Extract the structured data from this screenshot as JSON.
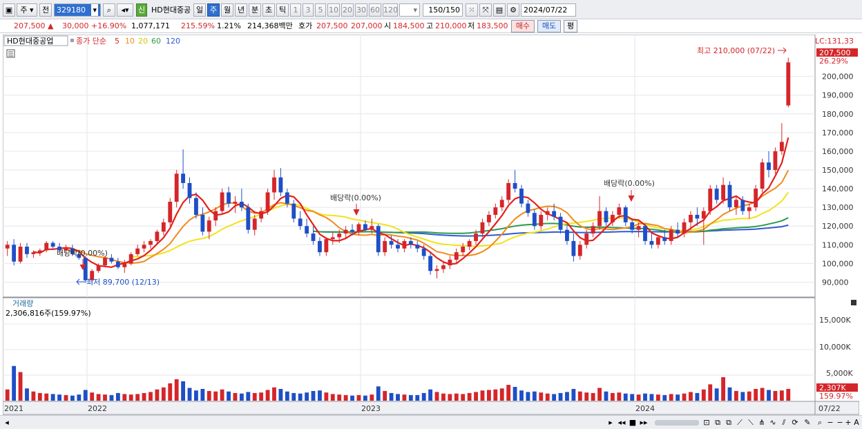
{
  "toolbar": {
    "market": "주",
    "prev": "전",
    "code": "329180",
    "shin": "신",
    "stock_name": "HD현대중공",
    "periods": [
      "일",
      "주",
      "월",
      "년",
      "분",
      "초",
      "틱"
    ],
    "active_period": "주",
    "intervals": [
      "1",
      "3",
      "5",
      "10",
      "20",
      "30",
      "60",
      "120"
    ],
    "count": "150",
    "count_total": "/150",
    "date": "2024/07/22"
  },
  "quote": {
    "price": "207,500",
    "change": "30,000",
    "change_pct": "+16.90%",
    "volume": "1,077,171",
    "volume_pct": "215.59%",
    "turnover_pct": "1.21%",
    "amount": "214,368백만",
    "bid_label": "호가",
    "ask": "207,500",
    "bid": "207,000",
    "open_label": "시",
    "open": "184,500",
    "high_label": "고",
    "high": "210,000",
    "low_label": "저",
    "low": "183,500",
    "buy_button": "매수",
    "sell_button": "매도",
    "avg_button": "평"
  },
  "legend": {
    "name": "HD현대중공업",
    "series_label": "종가 단순",
    "ma": [
      "5",
      "10",
      "20",
      "60",
      "120"
    ]
  },
  "colors": {
    "up": "#d4262a",
    "down": "#1e4fc6",
    "ma5": "#e3201b",
    "ma10": "#f08a1c",
    "ma20": "#f2e21a",
    "ma60": "#2e9a4c",
    "ma120": "#2d5ad6"
  },
  "price_axis": {
    "lc": "LC:131,33",
    "ticks": [
      "200,000",
      "190,000",
      "180,000",
      "170,000",
      "160,000",
      "150,000",
      "140,000",
      "130,000",
      "120,000",
      "110,000",
      "100,000",
      "90,000"
    ],
    "current_price_label": "207,500",
    "current_pct_label": "26.29%"
  },
  "annotations": {
    "high": "최고 210,000 (07/22)",
    "low": "최저 89,700 (12/13)",
    "dividend": "배당락(0.00%)"
  },
  "volume": {
    "title": "거래량",
    "max_label": "2,306,816주(159.97%)",
    "ticks": [
      "15,000K",
      "10,000K",
      "5,000K"
    ],
    "current_label": "2,307K",
    "current_pct": "159.97%"
  },
  "date_axis": [
    "2021",
    "2022",
    "2023",
    "2024",
    "07/22"
  ],
  "chart_data": {
    "type": "candlestick",
    "interval": "weekly",
    "ylim": [
      85000,
      215000
    ],
    "volume_ylim": [
      0,
      18000
    ],
    "candles": [
      [
        108000,
        112000,
        104000,
        110000,
        2200
      ],
      [
        110000,
        113000,
        99000,
        101000,
        6800
      ],
      [
        101000,
        111000,
        100000,
        109000,
        5600
      ],
      [
        109000,
        111000,
        103000,
        105000,
        2400
      ],
      [
        105000,
        107000,
        103000,
        106000,
        1800
      ],
      [
        106000,
        108000,
        104000,
        107000,
        1500
      ],
      [
        107000,
        112000,
        106000,
        111000,
        1400
      ],
      [
        111000,
        112000,
        108000,
        109000,
        1300
      ],
      [
        109000,
        111000,
        106000,
        107000,
        1200
      ],
      [
        107000,
        110000,
        105000,
        108000,
        1100
      ],
      [
        108000,
        110000,
        104000,
        105000,
        1000
      ],
      [
        105000,
        107000,
        102000,
        103000,
        1200
      ],
      [
        103000,
        104000,
        89700,
        91000,
        2100
      ],
      [
        91000,
        97000,
        90000,
        96000,
        1600
      ],
      [
        96000,
        100000,
        95000,
        99000,
        1300
      ],
      [
        99000,
        104000,
        98000,
        103000,
        1200
      ],
      [
        103000,
        105000,
        100000,
        101000,
        1100
      ],
      [
        101000,
        103000,
        97000,
        98000,
        1500
      ],
      [
        98000,
        102000,
        95000,
        100000,
        1300
      ],
      [
        100000,
        106000,
        99000,
        105000,
        1200
      ],
      [
        105000,
        110000,
        104000,
        108000,
        1300
      ],
      [
        108000,
        112000,
        106000,
        110000,
        1500
      ],
      [
        110000,
        113000,
        108000,
        112000,
        1700
      ],
      [
        112000,
        118000,
        110000,
        117000,
        2200
      ],
      [
        117000,
        124000,
        115000,
        122000,
        2600
      ],
      [
        122000,
        135000,
        120000,
        133000,
        3400
      ],
      [
        133000,
        150000,
        130000,
        148000,
        4200
      ],
      [
        148000,
        161000,
        140000,
        143000,
        3800
      ],
      [
        143000,
        146000,
        132000,
        135000,
        2500
      ],
      [
        135000,
        138000,
        124000,
        126000,
        2000
      ],
      [
        126000,
        130000,
        115000,
        117000,
        2300
      ],
      [
        117000,
        125000,
        113000,
        123000,
        1900
      ],
      [
        123000,
        130000,
        120000,
        128000,
        1800
      ],
      [
        128000,
        140000,
        126000,
        138000,
        2200
      ],
      [
        138000,
        141000,
        130000,
        132000,
        1800
      ],
      [
        132000,
        136000,
        127000,
        133000,
        1500
      ],
      [
        133000,
        140000,
        128000,
        130000,
        1400
      ],
      [
        130000,
        132000,
        116000,
        118000,
        1700
      ],
      [
        118000,
        126000,
        115000,
        124000,
        1500
      ],
      [
        124000,
        130000,
        122000,
        128000,
        1600
      ],
      [
        128000,
        140000,
        126000,
        138000,
        2100
      ],
      [
        138000,
        150000,
        134000,
        146000,
        2600
      ],
      [
        146000,
        151000,
        136000,
        138000,
        2300
      ],
      [
        138000,
        140000,
        130000,
        132000,
        1800
      ],
      [
        132000,
        134000,
        122000,
        124000,
        1500
      ],
      [
        124000,
        128000,
        118000,
        120000,
        1400
      ],
      [
        120000,
        124000,
        114000,
        116000,
        1600
      ],
      [
        116000,
        120000,
        110000,
        112000,
        1900
      ],
      [
        112000,
        114000,
        104000,
        106000,
        2000
      ],
      [
        106000,
        114000,
        104000,
        113000,
        1600
      ],
      [
        113000,
        117000,
        110000,
        114000,
        1300
      ],
      [
        114000,
        118000,
        111000,
        116000,
        1200
      ],
      [
        116000,
        120000,
        113000,
        118000,
        1100
      ],
      [
        118000,
        121000,
        115000,
        117000,
        1000
      ],
      [
        117000,
        122000,
        115000,
        121000,
        1100
      ],
      [
        121000,
        123000,
        117000,
        118000,
        1000
      ],
      [
        118000,
        124000,
        116000,
        120000,
        1200
      ],
      [
        120000,
        121000,
        104000,
        106000,
        2800
      ],
      [
        106000,
        114000,
        104000,
        112000,
        1900
      ],
      [
        112000,
        115000,
        108000,
        110000,
        1500
      ],
      [
        110000,
        113000,
        106000,
        108000,
        1300
      ],
      [
        108000,
        113000,
        106000,
        112000,
        1200
      ],
      [
        112000,
        114000,
        108000,
        110000,
        1100
      ],
      [
        110000,
        112000,
        106000,
        108000,
        1100
      ],
      [
        108000,
        110000,
        102000,
        104000,
        1500
      ],
      [
        104000,
        106000,
        94000,
        96000,
        2200
      ],
      [
        96000,
        99000,
        92000,
        97000,
        1700
      ],
      [
        97000,
        101000,
        95000,
        99000,
        1400
      ],
      [
        99000,
        104000,
        97000,
        102000,
        1300
      ],
      [
        102000,
        108000,
        100000,
        106000,
        1400
      ],
      [
        106000,
        111000,
        104000,
        109000,
        1300
      ],
      [
        109000,
        113000,
        107000,
        112000,
        1500
      ],
      [
        112000,
        118000,
        110000,
        116000,
        1700
      ],
      [
        116000,
        124000,
        114000,
        122000,
        2000
      ],
      [
        122000,
        128000,
        120000,
        126000,
        2100
      ],
      [
        126000,
        132000,
        124000,
        130000,
        2200
      ],
      [
        130000,
        136000,
        128000,
        134000,
        2400
      ],
      [
        134000,
        145000,
        132000,
        143000,
        3100
      ],
      [
        143000,
        150000,
        138000,
        140000,
        2700
      ],
      [
        140000,
        142000,
        130000,
        132000,
        2000
      ],
      [
        132000,
        134000,
        125000,
        127000,
        1700
      ],
      [
        127000,
        129000,
        118000,
        120000,
        1800
      ],
      [
        120000,
        128000,
        118000,
        126000,
        1600
      ],
      [
        126000,
        130000,
        123000,
        128000,
        1400
      ],
      [
        128000,
        132000,
        123000,
        125000,
        1300
      ],
      [
        125000,
        127000,
        116000,
        118000,
        1500
      ],
      [
        118000,
        120000,
        110000,
        112000,
        1700
      ],
      [
        112000,
        116000,
        101000,
        104000,
        2300
      ],
      [
        104000,
        112000,
        102000,
        110000,
        1800
      ],
      [
        110000,
        118000,
        108000,
        116000,
        1600
      ],
      [
        116000,
        122000,
        114000,
        120000,
        1500
      ],
      [
        120000,
        136000,
        118000,
        128000,
        2500
      ],
      [
        128000,
        130000,
        120000,
        122000,
        1800
      ],
      [
        122000,
        128000,
        120000,
        126000,
        1500
      ],
      [
        126000,
        132000,
        124000,
        130000,
        1600
      ],
      [
        130000,
        131000,
        120000,
        122000,
        1400
      ],
      [
        122000,
        124000,
        116000,
        118000,
        1300
      ],
      [
        118000,
        122000,
        114000,
        120000,
        1200
      ],
      [
        120000,
        121000,
        110000,
        112000,
        1400
      ],
      [
        112000,
        116000,
        108000,
        110000,
        1300
      ],
      [
        110000,
        115000,
        108000,
        114000,
        1200
      ],
      [
        114000,
        118000,
        110000,
        112000,
        1100
      ],
      [
        112000,
        120000,
        110000,
        118000,
        1300
      ],
      [
        118000,
        122000,
        114000,
        116000,
        1200
      ],
      [
        116000,
        124000,
        114000,
        122000,
        1400
      ],
      [
        122000,
        128000,
        118000,
        126000,
        1700
      ],
      [
        126000,
        130000,
        120000,
        124000,
        1500
      ],
      [
        124000,
        130000,
        110000,
        128000,
        2200
      ],
      [
        128000,
        142000,
        126000,
        140000,
        3200
      ],
      [
        140000,
        142000,
        132000,
        134000,
        2400
      ],
      [
        134000,
        146000,
        132000,
        142000,
        4600
      ],
      [
        142000,
        144000,
        128000,
        130000,
        2600
      ],
      [
        130000,
        136000,
        126000,
        134000,
        1900
      ],
      [
        134000,
        136000,
        126000,
        128000,
        1700
      ],
      [
        128000,
        132000,
        124000,
        130000,
        1800
      ],
      [
        130000,
        142000,
        128000,
        140000,
        2300
      ],
      [
        140000,
        156000,
        138000,
        154000,
        2500
      ],
      [
        154000,
        160000,
        146000,
        150000,
        2100
      ],
      [
        150000,
        162000,
        148000,
        160000,
        1900
      ],
      [
        160000,
        175000,
        158000,
        165000,
        2000
      ],
      [
        184500,
        210000,
        183500,
        207500,
        2307
      ]
    ]
  }
}
